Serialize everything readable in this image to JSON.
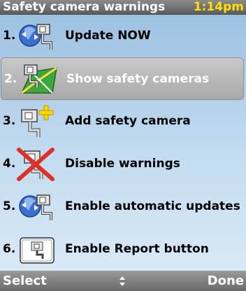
{
  "window": {
    "title": "Safety camera warnings",
    "clock": "1:14pm"
  },
  "menu": {
    "items": [
      {
        "number": "1.",
        "label": "Update NOW",
        "icon": "update-now-icon"
      },
      {
        "number": "2.",
        "label": "Show safety cameras",
        "icon": "map-camera-icon"
      },
      {
        "number": "3.",
        "label": "Add safety camera",
        "icon": "add-camera-icon"
      },
      {
        "number": "4.",
        "label": "Disable warnings",
        "icon": "disable-warnings-icon"
      },
      {
        "number": "5.",
        "label": "Enable automatic updates",
        "icon": "auto-update-icon"
      },
      {
        "number": "6.",
        "label": "Enable Report button",
        "icon": "report-button-icon"
      }
    ],
    "selected_index": 1
  },
  "softkeys": {
    "left": "Select",
    "right": "Done"
  },
  "colors": {
    "clock": "#ffe000",
    "selection": "#b0b0b0",
    "background": "#b5d3ec"
  }
}
